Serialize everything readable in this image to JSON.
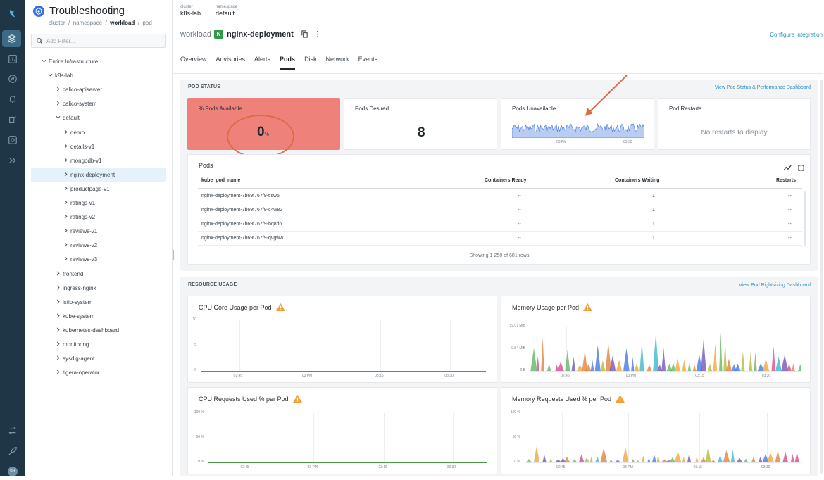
{
  "rail": {
    "icons": [
      "sysdig-logo-icon",
      "layers-icon",
      "chart-icon",
      "compass-icon",
      "alert-bell-icon",
      "policy-icon",
      "capture-icon",
      "expand-icon",
      "swap-icon",
      "rocket-icon",
      "avatar"
    ]
  },
  "avatar_initials": "SH",
  "header": {
    "title": "Troubleshooting"
  },
  "breadcrumb": {
    "cluster": "cluster",
    "namespace": "namespace",
    "workload": "workload",
    "pod": "pod"
  },
  "filter": {
    "placeholder": "Add Filter..."
  },
  "tree": [
    {
      "label": "Entire Infrastructure",
      "level": 0,
      "expanded": true
    },
    {
      "label": "k8s-lab",
      "level": 1,
      "expanded": true
    },
    {
      "label": "calico-apiserver",
      "level": 2
    },
    {
      "label": "calico-system",
      "level": 2
    },
    {
      "label": "default",
      "level": 2,
      "expanded": true
    },
    {
      "label": "demo",
      "level": 3
    },
    {
      "label": "details-v1",
      "level": 3
    },
    {
      "label": "mongodb-v1",
      "level": 3
    },
    {
      "label": "nginx-deployment",
      "level": 3,
      "selected": true
    },
    {
      "label": "productpage-v1",
      "level": 3
    },
    {
      "label": "ratings-v1",
      "level": 3
    },
    {
      "label": "ratings-v2",
      "level": 3
    },
    {
      "label": "reviews-v1",
      "level": 3
    },
    {
      "label": "reviews-v2",
      "level": 3
    },
    {
      "label": "reviews-v3",
      "level": 3
    },
    {
      "label": "frontend",
      "level": 2
    },
    {
      "label": "ingress-nginx",
      "level": 2
    },
    {
      "label": "istio-system",
      "level": 2
    },
    {
      "label": "kube-system",
      "level": 2
    },
    {
      "label": "kubernetes-dashboard",
      "level": 2
    },
    {
      "label": "monitoring",
      "level": 2
    },
    {
      "label": "sysdig-agent",
      "level": 2
    },
    {
      "label": "tigera-operator",
      "level": 2
    }
  ],
  "context": {
    "cluster_key": "cluster",
    "cluster_val": "k8s-lab",
    "namespace_key": "namespace",
    "namespace_val": "default"
  },
  "workload": {
    "label": "workload",
    "badge": "N",
    "name": "nginx-deployment"
  },
  "configure_link": "Configure Integration",
  "tabs": [
    "Overview",
    "Advisories",
    "Alerts",
    "Pods",
    "Disk",
    "Network",
    "Events"
  ],
  "active_tab": "Pods",
  "pod_status": {
    "title": "POD STATUS",
    "link": "View Pod Status & Performance Dashboard",
    "cards": {
      "available": {
        "title": "% Pods Available",
        "value": "0",
        "unit": "%"
      },
      "desired": {
        "title": "Pods Desired",
        "value": "8"
      },
      "unavailable": {
        "title": "Pods Unavailable",
        "ticks": [
          "03 PM",
          "03:30"
        ]
      },
      "restarts": {
        "title": "Pod Restarts",
        "empty": "No restarts to display"
      }
    }
  },
  "pods_table": {
    "title": "Pods",
    "columns": [
      "kube_pod_name",
      "Containers Ready",
      "Containers Waiting",
      "Restarts"
    ],
    "rows": [
      [
        "nginx-deployment-7b69f767f9-tlsw5",
        "--",
        "1",
        "--"
      ],
      [
        "nginx-deployment-7b69f767f9-c4w82",
        "--",
        "1",
        "--"
      ],
      [
        "nginx-deployment-7b69f767f9-bq8d6",
        "--",
        "1",
        "--"
      ],
      [
        "nginx-deployment-7b69f767f9-qvgww",
        "--",
        "1",
        "--"
      ]
    ],
    "footer": "Showing 1-250 of 681 rows."
  },
  "resource_usage": {
    "title": "RESOURCE USAGE",
    "link": "View Pod Rightsizing Dashboard",
    "charts": {
      "cpu": {
        "title": "CPU Core Usage per Pod",
        "yticks": [
          "10",
          "5",
          "0"
        ],
        "xticks": [
          "02:45",
          "03 PM",
          "03:15",
          "03:30"
        ]
      },
      "mem": {
        "title": "Memory Usage per Pod",
        "yticks": [
          "19.07 MiB",
          "9.54 MiB",
          "0 B"
        ],
        "xticks": [
          "02:45",
          "03 PM",
          "03:15",
          "03:30"
        ]
      },
      "cpureq": {
        "title": "CPU Requests Used % per Pod",
        "yticks": [
          "100 %",
          "50 %",
          "0 %"
        ],
        "xticks": [
          "02:45",
          "03 PM",
          "03:15",
          "03:30"
        ]
      },
      "memreq": {
        "title": "Memory Requests Used % per Pod",
        "yticks": [
          "100 %",
          "50 %",
          "0 %"
        ],
        "xticks": [
          "02:45",
          "03 PM",
          "03:15",
          "03:30"
        ]
      }
    }
  },
  "colors": {
    "rail": "#1f3647",
    "accent": "#2a8fc7",
    "alert_card": "#ee827b",
    "annotation": "#e06a46",
    "warning": "#f0a030"
  }
}
